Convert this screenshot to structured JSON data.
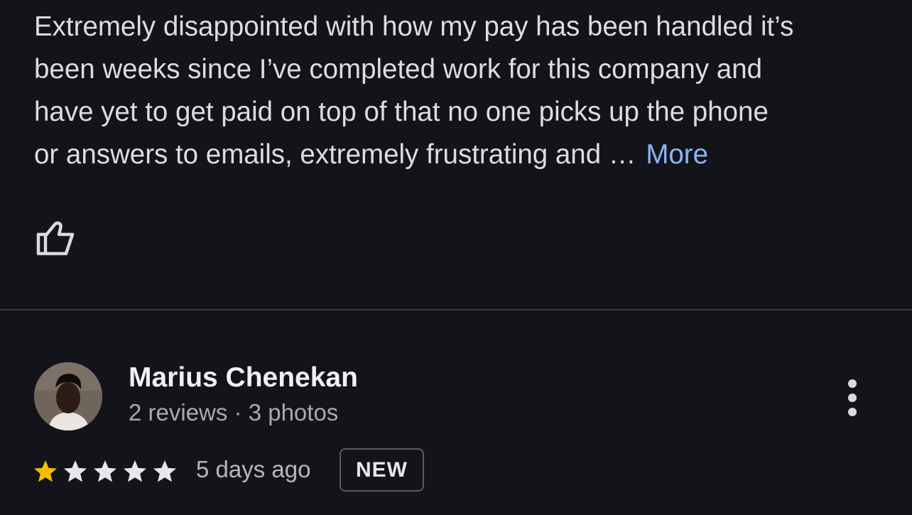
{
  "review_previous": {
    "text_lines": [
      "Extremely disappointed with how my pay has been handled it’s",
      "been weeks since I’ve completed work for this company and",
      "have yet to get paid on top of that no one picks up the phone",
      "or answers to emails, extremely frustrating and …"
    ],
    "more_label": "More",
    "like_icon": "thumbs-up-icon"
  },
  "review": {
    "reviewer_name": "Marius Chenekan",
    "reviewer_meta": "2 reviews · 3 photos",
    "rating": 1,
    "rating_max": 5,
    "date": "5 days ago",
    "badge": "NEW",
    "menu_icon": "more-vert-icon"
  },
  "colors": {
    "background": "#131419",
    "link": "#8ab4f8",
    "star_filled": "#fbbc04",
    "star_empty": "#e8e8ea"
  }
}
